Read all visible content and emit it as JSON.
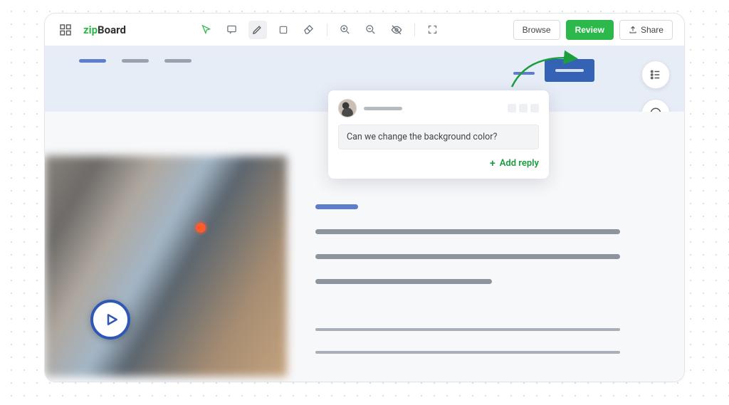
{
  "brand": {
    "part1": "zip",
    "part2": "Board"
  },
  "toolbar": {
    "browse": "Browse",
    "review": "Review",
    "share": "Share"
  },
  "tools": {
    "cursor": "cursor-icon",
    "comment": "comment-icon",
    "pencil": "pencil-icon",
    "rect": "rectangle-icon",
    "eraser": "eraser-icon",
    "zoom_in": "zoom-in-icon",
    "zoom_out": "zoom-out-icon",
    "eye": "hide-annotations-icon",
    "full": "fullscreen-icon"
  },
  "side": {
    "list": "task-list-button",
    "info": "info-button"
  },
  "comment": {
    "author": "user",
    "body": "Can we change the background color?",
    "add_reply": "Add reply"
  }
}
